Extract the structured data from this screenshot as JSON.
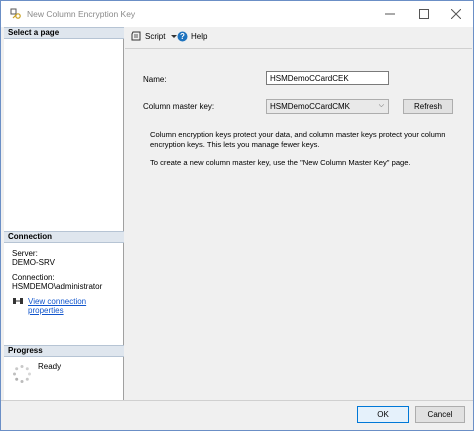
{
  "window": {
    "title": "New Column Encryption Key",
    "icon": "key-icon",
    "buttons": {
      "minimize": "—",
      "maximize": "☐",
      "close": "✕"
    }
  },
  "left": {
    "select_page_header": "Select a page",
    "connection_header": "Connection",
    "server_label": "Server:",
    "server_value": "DEMO-SRV",
    "connection_label": "Connection:",
    "connection_value": "HSMDEMO\\administrator",
    "view_connection_link": "View connection properties",
    "progress_header": "Progress",
    "progress_status": "Ready"
  },
  "toolbar": {
    "script_label": "Script",
    "help_label": "Help"
  },
  "form": {
    "name_label": "Name:",
    "name_value": "HSMDemoCCardCEK",
    "cmk_label": "Column master key:",
    "cmk_value": "HSMDemoCCardCMK",
    "refresh_label": "Refresh",
    "info_line1": "Column encryption keys protect your data, and column master keys protect your column encryption keys. This lets you manage fewer keys.",
    "info_line2": "To create a new column master key, use the \"New Column Master Key\" page."
  },
  "footer": {
    "ok_label": "OK",
    "cancel_label": "Cancel"
  },
  "colors": {
    "accent": "#0078d7",
    "link": "#1155cc",
    "section_header_bg": "#dfe6ee"
  }
}
